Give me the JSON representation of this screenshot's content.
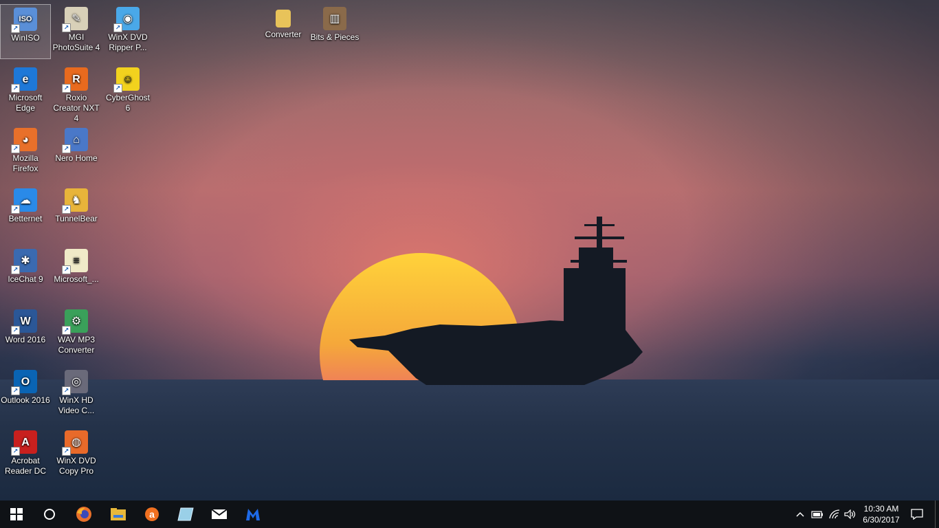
{
  "desktop": {
    "icons": [
      {
        "label": "WinISO",
        "icon": "winiso-icon",
        "color": "#5a8fd8",
        "glyph": "ISO"
      },
      {
        "label": "MGI PhotoSuite 4",
        "icon": "photosuite-icon",
        "color": "#d8d0b8",
        "glyph": "✎"
      },
      {
        "label": "WinX DVD Ripper P...",
        "icon": "winx-dvd-ripper-icon",
        "color": "#4aa8e8",
        "glyph": "◉"
      },
      {
        "label": "Converter",
        "icon": "folder-icon",
        "color": "#e8c35a",
        "glyph": ""
      },
      {
        "label": "Bits & Pieces",
        "icon": "bits-pieces-icon",
        "color": "#8a6a4a",
        "glyph": "▥"
      },
      {
        "label": "Microsoft Edge",
        "icon": "edge-icon",
        "color": "#1e78d8",
        "glyph": "e"
      },
      {
        "label": "Roxio Creator NXT 4",
        "icon": "roxio-icon",
        "color": "#e86a1e",
        "glyph": "R"
      },
      {
        "label": "CyberGhost 6",
        "icon": "cyberghost-icon",
        "color": "#f2d21e",
        "glyph": "☺"
      },
      {
        "label": "Mozilla Firefox",
        "icon": "firefox-icon",
        "color": "#e8702a",
        "glyph": "◕"
      },
      {
        "label": "Nero Home",
        "icon": "nero-home-icon",
        "color": "#4a78c8",
        "glyph": "⌂"
      },
      {
        "label": "Betternet",
        "icon": "betternet-icon",
        "color": "#2a8ae8",
        "glyph": "☁"
      },
      {
        "label": "TunnelBear",
        "icon": "tunnelbear-icon",
        "color": "#e8b43a",
        "glyph": "♞"
      },
      {
        "label": "IceChat 9",
        "icon": "icechat-icon",
        "color": "#3a6ab0",
        "glyph": "✱"
      },
      {
        "label": "Microsoft_...",
        "icon": "document-icon",
        "color": "#f0eac8",
        "glyph": "≡"
      },
      {
        "label": "Word 2016",
        "icon": "word-icon",
        "color": "#2b5797",
        "glyph": "W"
      },
      {
        "label": "WAV MP3 Converter",
        "icon": "wav-mp3-converter-icon",
        "color": "#3aa05a",
        "glyph": "⚙"
      },
      {
        "label": "Outlook 2016",
        "icon": "outlook-icon",
        "color": "#0a64b4",
        "glyph": "O"
      },
      {
        "label": "WinX HD Video C...",
        "icon": "winx-hd-video-icon",
        "color": "#6a6a7a",
        "glyph": "◎"
      },
      {
        "label": "Acrobat Reader DC",
        "icon": "acrobat-icon",
        "color": "#c8201e",
        "glyph": "A"
      },
      {
        "label": "WinX DVD Copy Pro",
        "icon": "winx-dvd-copy-icon",
        "color": "#e86a2a",
        "glyph": "◍"
      }
    ]
  },
  "taskbar": {
    "pinned": [
      {
        "name": "start-button",
        "icon": "windows-logo-icon"
      },
      {
        "name": "cortana-button",
        "icon": "cortana-circle-icon"
      },
      {
        "name": "taskbar-firefox",
        "icon": "firefox-icon"
      },
      {
        "name": "taskbar-file-explorer",
        "icon": "file-explorer-icon"
      },
      {
        "name": "taskbar-avast",
        "icon": "avast-icon"
      },
      {
        "name": "taskbar-app",
        "icon": "notebook-icon"
      },
      {
        "name": "taskbar-mail",
        "icon": "mail-icon"
      },
      {
        "name": "taskbar-malwarebytes",
        "icon": "malwarebytes-icon"
      }
    ],
    "clock": {
      "time": "10:30 AM",
      "date": "6/30/2017"
    }
  },
  "colors": {
    "taskbar": "#0f1216",
    "accent": "#1e78d8"
  }
}
